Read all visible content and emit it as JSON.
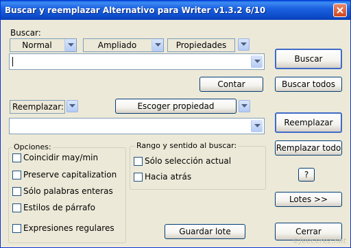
{
  "window": {
    "title": "Buscar y reemplazar Alternativo para Writer v1.3.2  6/10"
  },
  "search": {
    "label": "Buscar:",
    "mode_normal": "Normal",
    "mode_extended": "Ampliado",
    "mode_properties": "Propiedades",
    "value": ""
  },
  "replace": {
    "selector": "Reemplazar:",
    "choose_property": "Escoger propiedad",
    "value": ""
  },
  "buttons": {
    "find": "Buscar",
    "count": "Contar",
    "find_all": "Buscar todos",
    "replace": "Reemplazar",
    "replace_all": "Remplazar todo",
    "help": "?",
    "batches": "Lotes >>",
    "save_batch": "Guardar lote",
    "close": "Cerrar"
  },
  "options": {
    "title": "Opciones:",
    "items": [
      {
        "label": "Coincidir may/min",
        "checked": false
      },
      {
        "label": "Preserve capitalization",
        "checked": false
      },
      {
        "label": "Sólo palabras enteras",
        "checked": false
      },
      {
        "label": "Estilos de párrafo",
        "checked": false
      },
      {
        "label": "Expresiones regulares",
        "checked": false
      }
    ]
  },
  "range": {
    "title": "Rango y sentido al buscar:",
    "items": [
      {
        "label": "Sólo selección actual",
        "checked": false
      },
      {
        "label": "Hacia atrás",
        "checked": false
      }
    ]
  },
  "watermark": "©Jeecerez.net"
}
